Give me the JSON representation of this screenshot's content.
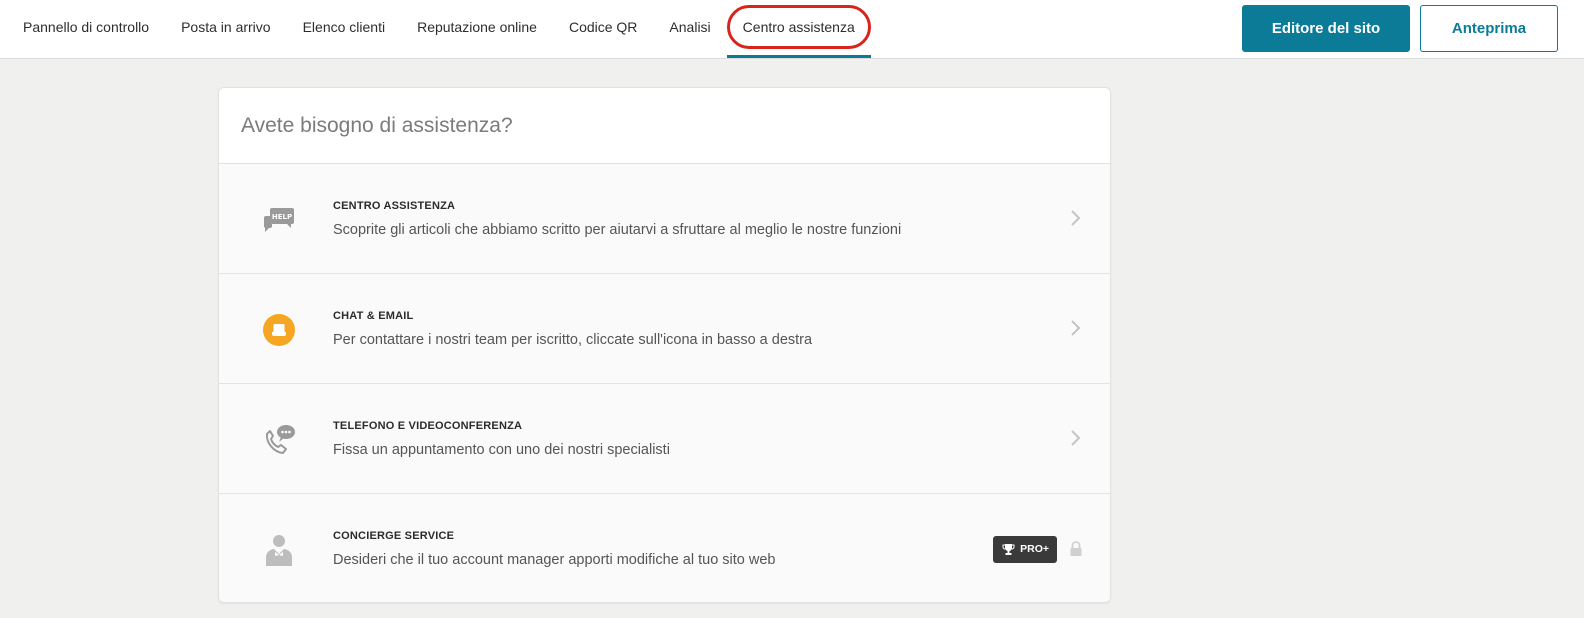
{
  "nav": {
    "items": [
      {
        "label": "Pannello di controllo"
      },
      {
        "label": "Posta in arrivo"
      },
      {
        "label": "Elenco clienti"
      },
      {
        "label": "Reputazione online"
      },
      {
        "label": "Codice QR"
      },
      {
        "label": "Analisi"
      },
      {
        "label": "Centro assistenza",
        "active": true
      }
    ]
  },
  "header_buttons": {
    "editor_label": "Editore del sito",
    "preview_label": "Anteprima"
  },
  "card": {
    "title": "Avete bisogno di assistenza?",
    "rows": [
      {
        "icon": "help-chat-icon",
        "title": "CENTRO ASSISTENZA",
        "description": "Scoprite gli articoli che abbiamo scritto per aiutarvi a sfruttare al meglio le nostre funzioni"
      },
      {
        "icon": "chat-inbox-icon",
        "title": "CHAT & EMAIL",
        "description": "Per contattare i nostri team per iscritto, cliccate sull'icona in basso a destra"
      },
      {
        "icon": "phone-chat-icon",
        "title": "TELEFONO E VIDEOCONFERENZA",
        "description": "Fissa un appuntamento con uno dei nostri specialisti"
      },
      {
        "icon": "concierge-icon",
        "title": "CONCIERGE SERVICE",
        "description": "Desideri che il tuo account manager apporti modifiche al tuo sito web",
        "badge": "PRO+",
        "locked": true
      }
    ]
  },
  "colors": {
    "accent": "#0b7b98",
    "highlight_ring": "#d9241b",
    "chat_icon": "#f5a623",
    "background": "#f0f0ef"
  }
}
